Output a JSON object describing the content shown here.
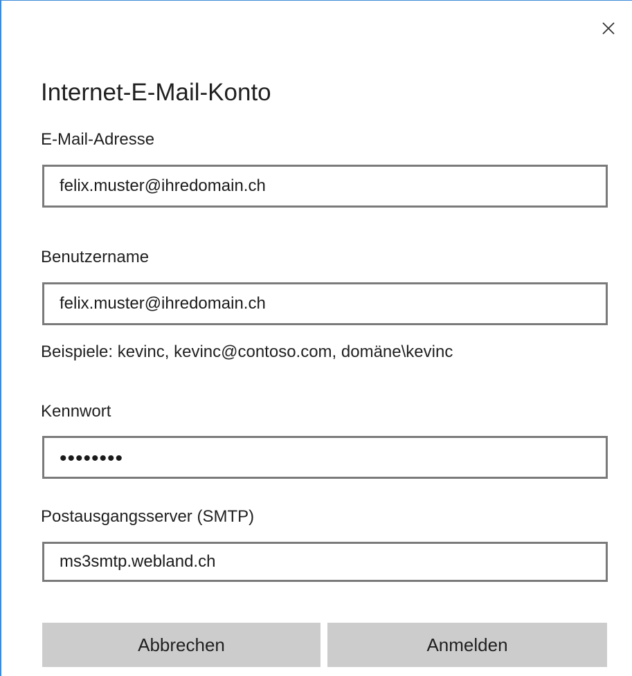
{
  "dialog": {
    "close_icon": "close-icon",
    "title": "Internet-E-Mail-Konto"
  },
  "form": {
    "email": {
      "label": "E-Mail-Adresse",
      "value": "felix.muster@ihredomain.ch"
    },
    "username": {
      "label": "Benutzername",
      "value": "felix.muster@ihredomain.ch",
      "hint": "Beispiele: kevinc, kevinc@contoso.com, domäne\\kevinc"
    },
    "password": {
      "label": "Kennwort",
      "value": "••••••••"
    },
    "smtp": {
      "label": "Postausgangsserver (SMTP)",
      "value": "ms3smtp.webland.ch"
    }
  },
  "buttons": {
    "cancel_label": "Abbrechen",
    "signin_label": "Anmelden"
  },
  "colors": {
    "accent_border": "#3c8ad8",
    "field_border": "#7a7a7a",
    "button_bg": "#cccccc"
  }
}
